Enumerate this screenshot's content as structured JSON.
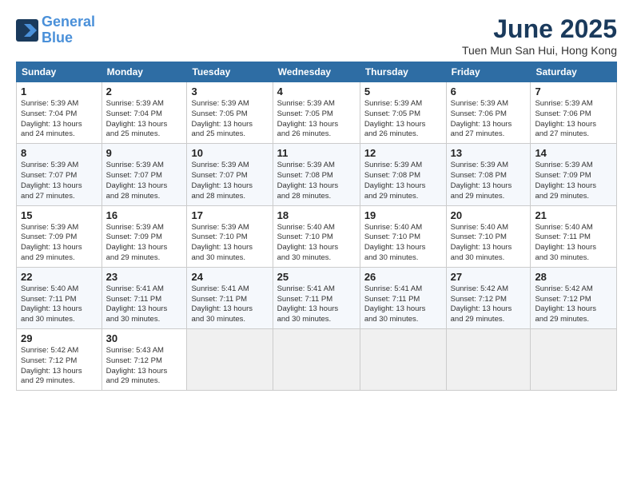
{
  "header": {
    "logo_line1": "General",
    "logo_line2": "Blue",
    "month": "June 2025",
    "location": "Tuen Mun San Hui, Hong Kong"
  },
  "weekdays": [
    "Sunday",
    "Monday",
    "Tuesday",
    "Wednesday",
    "Thursday",
    "Friday",
    "Saturday"
  ],
  "weeks": [
    [
      {
        "day": "1",
        "info": "Sunrise: 5:39 AM\nSunset: 7:04 PM\nDaylight: 13 hours\nand 24 minutes."
      },
      {
        "day": "2",
        "info": "Sunrise: 5:39 AM\nSunset: 7:04 PM\nDaylight: 13 hours\nand 25 minutes."
      },
      {
        "day": "3",
        "info": "Sunrise: 5:39 AM\nSunset: 7:05 PM\nDaylight: 13 hours\nand 25 minutes."
      },
      {
        "day": "4",
        "info": "Sunrise: 5:39 AM\nSunset: 7:05 PM\nDaylight: 13 hours\nand 26 minutes."
      },
      {
        "day": "5",
        "info": "Sunrise: 5:39 AM\nSunset: 7:05 PM\nDaylight: 13 hours\nand 26 minutes."
      },
      {
        "day": "6",
        "info": "Sunrise: 5:39 AM\nSunset: 7:06 PM\nDaylight: 13 hours\nand 27 minutes."
      },
      {
        "day": "7",
        "info": "Sunrise: 5:39 AM\nSunset: 7:06 PM\nDaylight: 13 hours\nand 27 minutes."
      }
    ],
    [
      {
        "day": "8",
        "info": "Sunrise: 5:39 AM\nSunset: 7:07 PM\nDaylight: 13 hours\nand 27 minutes."
      },
      {
        "day": "9",
        "info": "Sunrise: 5:39 AM\nSunset: 7:07 PM\nDaylight: 13 hours\nand 28 minutes."
      },
      {
        "day": "10",
        "info": "Sunrise: 5:39 AM\nSunset: 7:07 PM\nDaylight: 13 hours\nand 28 minutes."
      },
      {
        "day": "11",
        "info": "Sunrise: 5:39 AM\nSunset: 7:08 PM\nDaylight: 13 hours\nand 28 minutes."
      },
      {
        "day": "12",
        "info": "Sunrise: 5:39 AM\nSunset: 7:08 PM\nDaylight: 13 hours\nand 29 minutes."
      },
      {
        "day": "13",
        "info": "Sunrise: 5:39 AM\nSunset: 7:08 PM\nDaylight: 13 hours\nand 29 minutes."
      },
      {
        "day": "14",
        "info": "Sunrise: 5:39 AM\nSunset: 7:09 PM\nDaylight: 13 hours\nand 29 minutes."
      }
    ],
    [
      {
        "day": "15",
        "info": "Sunrise: 5:39 AM\nSunset: 7:09 PM\nDaylight: 13 hours\nand 29 minutes."
      },
      {
        "day": "16",
        "info": "Sunrise: 5:39 AM\nSunset: 7:09 PM\nDaylight: 13 hours\nand 29 minutes."
      },
      {
        "day": "17",
        "info": "Sunrise: 5:39 AM\nSunset: 7:10 PM\nDaylight: 13 hours\nand 30 minutes."
      },
      {
        "day": "18",
        "info": "Sunrise: 5:40 AM\nSunset: 7:10 PM\nDaylight: 13 hours\nand 30 minutes."
      },
      {
        "day": "19",
        "info": "Sunrise: 5:40 AM\nSunset: 7:10 PM\nDaylight: 13 hours\nand 30 minutes."
      },
      {
        "day": "20",
        "info": "Sunrise: 5:40 AM\nSunset: 7:10 PM\nDaylight: 13 hours\nand 30 minutes."
      },
      {
        "day": "21",
        "info": "Sunrise: 5:40 AM\nSunset: 7:11 PM\nDaylight: 13 hours\nand 30 minutes."
      }
    ],
    [
      {
        "day": "22",
        "info": "Sunrise: 5:40 AM\nSunset: 7:11 PM\nDaylight: 13 hours\nand 30 minutes."
      },
      {
        "day": "23",
        "info": "Sunrise: 5:41 AM\nSunset: 7:11 PM\nDaylight: 13 hours\nand 30 minutes."
      },
      {
        "day": "24",
        "info": "Sunrise: 5:41 AM\nSunset: 7:11 PM\nDaylight: 13 hours\nand 30 minutes."
      },
      {
        "day": "25",
        "info": "Sunrise: 5:41 AM\nSunset: 7:11 PM\nDaylight: 13 hours\nand 30 minutes."
      },
      {
        "day": "26",
        "info": "Sunrise: 5:41 AM\nSunset: 7:11 PM\nDaylight: 13 hours\nand 30 minutes."
      },
      {
        "day": "27",
        "info": "Sunrise: 5:42 AM\nSunset: 7:12 PM\nDaylight: 13 hours\nand 29 minutes."
      },
      {
        "day": "28",
        "info": "Sunrise: 5:42 AM\nSunset: 7:12 PM\nDaylight: 13 hours\nand 29 minutes."
      }
    ],
    [
      {
        "day": "29",
        "info": "Sunrise: 5:42 AM\nSunset: 7:12 PM\nDaylight: 13 hours\nand 29 minutes."
      },
      {
        "day": "30",
        "info": "Sunrise: 5:43 AM\nSunset: 7:12 PM\nDaylight: 13 hours\nand 29 minutes."
      },
      {
        "day": "",
        "info": ""
      },
      {
        "day": "",
        "info": ""
      },
      {
        "day": "",
        "info": ""
      },
      {
        "day": "",
        "info": ""
      },
      {
        "day": "",
        "info": ""
      }
    ]
  ]
}
